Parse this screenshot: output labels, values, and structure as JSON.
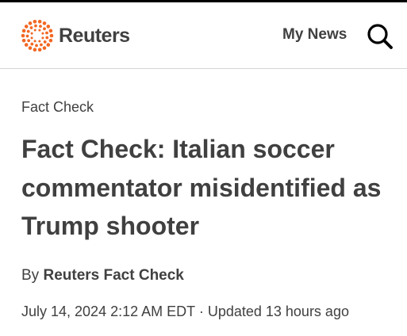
{
  "header": {
    "brand": "Reuters",
    "my_news": "My News",
    "search_icon": "search-icon",
    "brand_color": "#f26722",
    "text_color": "#404040"
  },
  "article": {
    "section": "Fact Check",
    "headline": "Fact Check: Italian soccer commentator misidentified as Trump shooter",
    "byline_prefix": "By",
    "author": "Reuters Fact Check",
    "published": "July 14, 2024 2:12 AM EDT",
    "separator": "·",
    "updated": "Updated 13 hours ago"
  }
}
